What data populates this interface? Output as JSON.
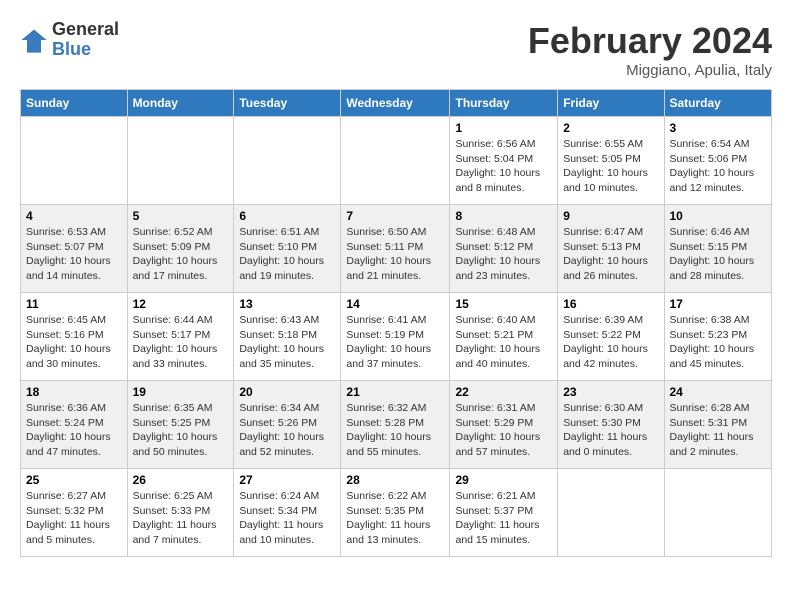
{
  "logo": {
    "general": "General",
    "blue": "Blue"
  },
  "title": "February 2024",
  "location": "Miggiano, Apulia, Italy",
  "days_of_week": [
    "Sunday",
    "Monday",
    "Tuesday",
    "Wednesday",
    "Thursday",
    "Friday",
    "Saturday"
  ],
  "weeks": [
    [
      {
        "day": "",
        "info": ""
      },
      {
        "day": "",
        "info": ""
      },
      {
        "day": "",
        "info": ""
      },
      {
        "day": "",
        "info": ""
      },
      {
        "day": "1",
        "info": "Sunrise: 6:56 AM\nSunset: 5:04 PM\nDaylight: 10 hours\nand 8 minutes."
      },
      {
        "day": "2",
        "info": "Sunrise: 6:55 AM\nSunset: 5:05 PM\nDaylight: 10 hours\nand 10 minutes."
      },
      {
        "day": "3",
        "info": "Sunrise: 6:54 AM\nSunset: 5:06 PM\nDaylight: 10 hours\nand 12 minutes."
      }
    ],
    [
      {
        "day": "4",
        "info": "Sunrise: 6:53 AM\nSunset: 5:07 PM\nDaylight: 10 hours\nand 14 minutes."
      },
      {
        "day": "5",
        "info": "Sunrise: 6:52 AM\nSunset: 5:09 PM\nDaylight: 10 hours\nand 17 minutes."
      },
      {
        "day": "6",
        "info": "Sunrise: 6:51 AM\nSunset: 5:10 PM\nDaylight: 10 hours\nand 19 minutes."
      },
      {
        "day": "7",
        "info": "Sunrise: 6:50 AM\nSunset: 5:11 PM\nDaylight: 10 hours\nand 21 minutes."
      },
      {
        "day": "8",
        "info": "Sunrise: 6:48 AM\nSunset: 5:12 PM\nDaylight: 10 hours\nand 23 minutes."
      },
      {
        "day": "9",
        "info": "Sunrise: 6:47 AM\nSunset: 5:13 PM\nDaylight: 10 hours\nand 26 minutes."
      },
      {
        "day": "10",
        "info": "Sunrise: 6:46 AM\nSunset: 5:15 PM\nDaylight: 10 hours\nand 28 minutes."
      }
    ],
    [
      {
        "day": "11",
        "info": "Sunrise: 6:45 AM\nSunset: 5:16 PM\nDaylight: 10 hours\nand 30 minutes."
      },
      {
        "day": "12",
        "info": "Sunrise: 6:44 AM\nSunset: 5:17 PM\nDaylight: 10 hours\nand 33 minutes."
      },
      {
        "day": "13",
        "info": "Sunrise: 6:43 AM\nSunset: 5:18 PM\nDaylight: 10 hours\nand 35 minutes."
      },
      {
        "day": "14",
        "info": "Sunrise: 6:41 AM\nSunset: 5:19 PM\nDaylight: 10 hours\nand 37 minutes."
      },
      {
        "day": "15",
        "info": "Sunrise: 6:40 AM\nSunset: 5:21 PM\nDaylight: 10 hours\nand 40 minutes."
      },
      {
        "day": "16",
        "info": "Sunrise: 6:39 AM\nSunset: 5:22 PM\nDaylight: 10 hours\nand 42 minutes."
      },
      {
        "day": "17",
        "info": "Sunrise: 6:38 AM\nSunset: 5:23 PM\nDaylight: 10 hours\nand 45 minutes."
      }
    ],
    [
      {
        "day": "18",
        "info": "Sunrise: 6:36 AM\nSunset: 5:24 PM\nDaylight: 10 hours\nand 47 minutes."
      },
      {
        "day": "19",
        "info": "Sunrise: 6:35 AM\nSunset: 5:25 PM\nDaylight: 10 hours\nand 50 minutes."
      },
      {
        "day": "20",
        "info": "Sunrise: 6:34 AM\nSunset: 5:26 PM\nDaylight: 10 hours\nand 52 minutes."
      },
      {
        "day": "21",
        "info": "Sunrise: 6:32 AM\nSunset: 5:28 PM\nDaylight: 10 hours\nand 55 minutes."
      },
      {
        "day": "22",
        "info": "Sunrise: 6:31 AM\nSunset: 5:29 PM\nDaylight: 10 hours\nand 57 minutes."
      },
      {
        "day": "23",
        "info": "Sunrise: 6:30 AM\nSunset: 5:30 PM\nDaylight: 11 hours\nand 0 minutes."
      },
      {
        "day": "24",
        "info": "Sunrise: 6:28 AM\nSunset: 5:31 PM\nDaylight: 11 hours\nand 2 minutes."
      }
    ],
    [
      {
        "day": "25",
        "info": "Sunrise: 6:27 AM\nSunset: 5:32 PM\nDaylight: 11 hours\nand 5 minutes."
      },
      {
        "day": "26",
        "info": "Sunrise: 6:25 AM\nSunset: 5:33 PM\nDaylight: 11 hours\nand 7 minutes."
      },
      {
        "day": "27",
        "info": "Sunrise: 6:24 AM\nSunset: 5:34 PM\nDaylight: 11 hours\nand 10 minutes."
      },
      {
        "day": "28",
        "info": "Sunrise: 6:22 AM\nSunset: 5:35 PM\nDaylight: 11 hours\nand 13 minutes."
      },
      {
        "day": "29",
        "info": "Sunrise: 6:21 AM\nSunset: 5:37 PM\nDaylight: 11 hours\nand 15 minutes."
      },
      {
        "day": "",
        "info": ""
      },
      {
        "day": "",
        "info": ""
      }
    ]
  ]
}
